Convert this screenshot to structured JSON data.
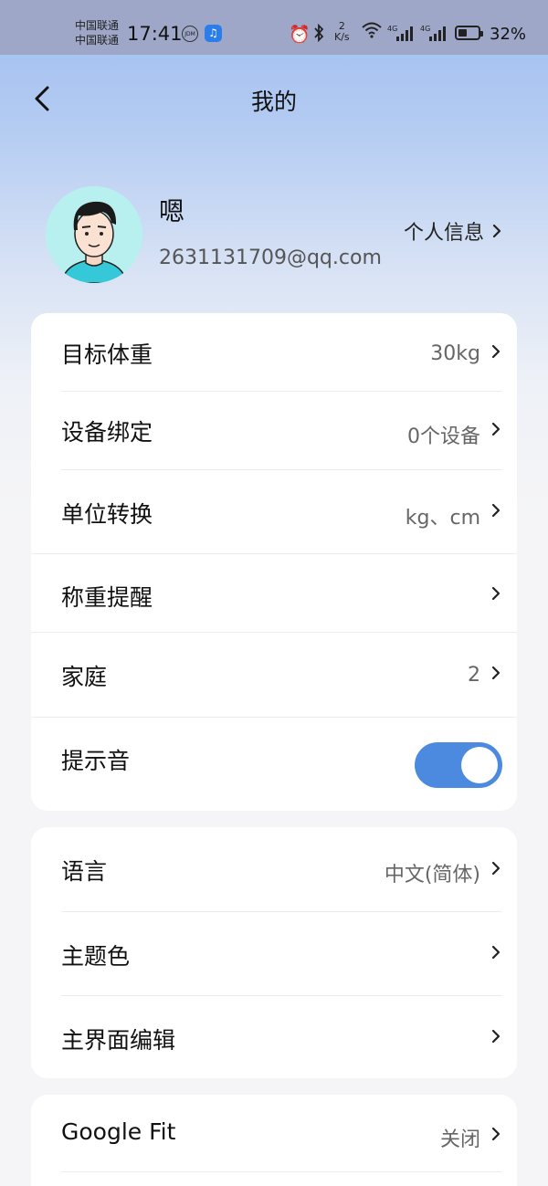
{
  "status_bar": {
    "carrier_1": "中国联通",
    "carrier_2": "中国联通",
    "time": "17:41",
    "jdm_label": "JDM",
    "net_speed_top": "2",
    "net_speed_bottom": "K/s",
    "signal_1": "4G",
    "signal_2": "4G",
    "battery": "32%",
    "battery_level": 0.32,
    "icons": [
      "jdm-icon",
      "music-app-icon",
      "alarm-icon",
      "bluetooth-icon",
      "wifi-icon",
      "signal-icon",
      "signal-icon",
      "battery-icon"
    ]
  },
  "header": {
    "title": "我的",
    "back_icon": "chevron-left-icon"
  },
  "profile": {
    "nickname": "嗯",
    "email": "2631131709@qq.com",
    "info_link": "个人信息"
  },
  "settings_group_1": [
    {
      "label": "目标体重",
      "value": "30kg"
    },
    {
      "label": "设备绑定",
      "value": "0个设备"
    },
    {
      "label": "单位转换",
      "value": "kg、cm"
    },
    {
      "label": "称重提醒",
      "value": ""
    },
    {
      "label": "家庭",
      "value": "2"
    },
    {
      "label": "提示音",
      "toggle_on": true
    }
  ],
  "settings_group_2": [
    {
      "label": "语言",
      "value": "中文(简体)"
    },
    {
      "label": "主题色",
      "value": ""
    },
    {
      "label": "主界面编辑",
      "value": ""
    }
  ],
  "settings_group_3": [
    {
      "label": "Google Fit",
      "value": "关闭"
    }
  ],
  "colors": {
    "toggle_on": "#4c8ae0",
    "header_gradient_top": "#9fbdf0",
    "avatar_bg": "#b8f0f0"
  }
}
